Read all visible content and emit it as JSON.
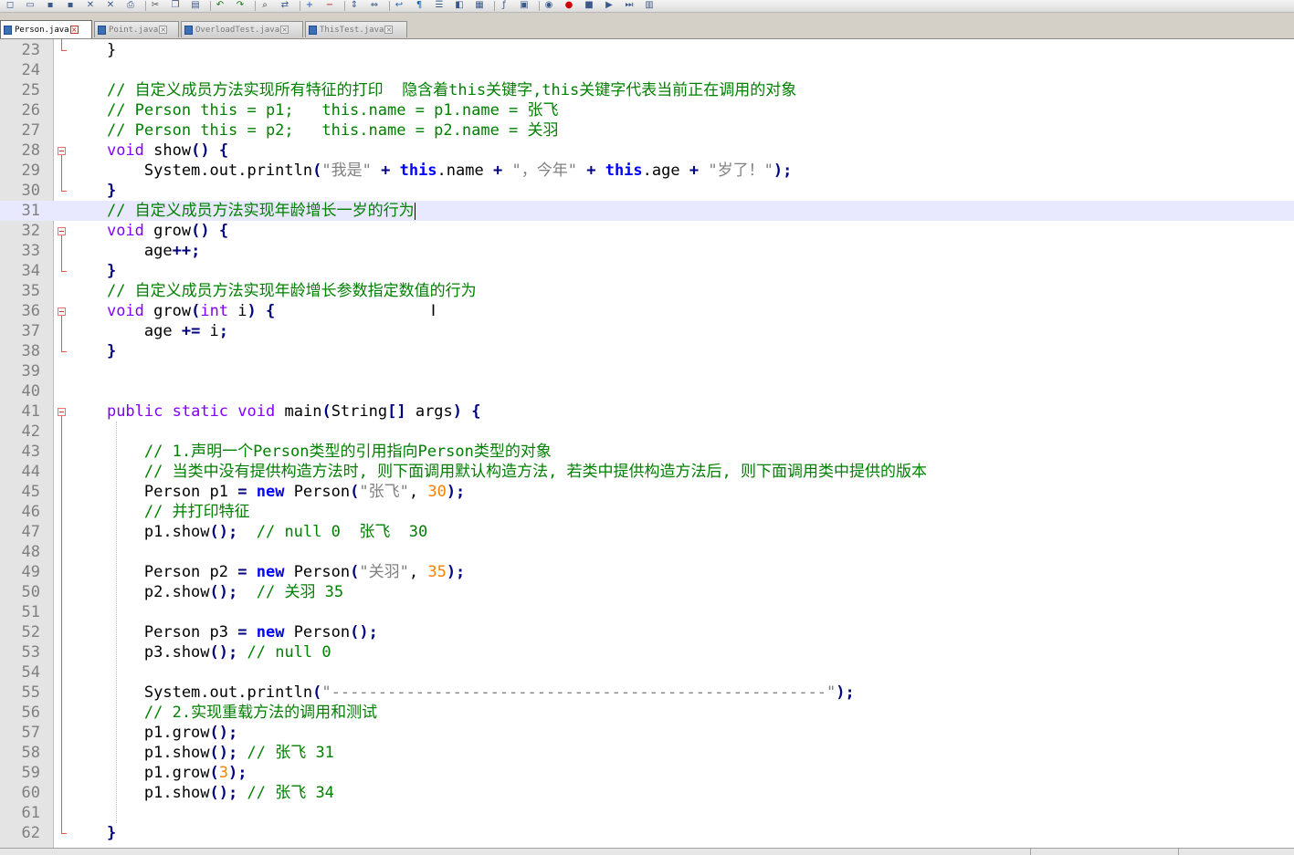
{
  "toolbar": {
    "buttons": [
      "new-file-icon",
      "open-folder-icon",
      "save-icon",
      "save-all-icon",
      "close-icon",
      "close-all-icon",
      "print-icon",
      "cut-icon",
      "copy-icon",
      "paste-icon",
      "undo-icon",
      "redo-icon",
      "find-icon",
      "replace-icon",
      "zoom-in-icon",
      "zoom-out-icon",
      "sync-vertical-icon",
      "sync-horizontal-icon",
      "word-wrap-icon",
      "show-all-chars-icon",
      "indent-guide-icon",
      "user-defined-language-icon",
      "document-map-icon",
      "function-list-icon",
      "folder-as-workspace-icon",
      "monitoring-icon",
      "record-macro-icon",
      "stop-recording-icon",
      "playback-macro-icon",
      "run-macro-multiple-icon",
      "save-macro-icon"
    ]
  },
  "tabs": [
    {
      "label": "Person.java",
      "active": true
    },
    {
      "label": "Point.java",
      "active": false
    },
    {
      "label": "OverloadTest.java",
      "active": false
    },
    {
      "label": "ThisTest.java",
      "active": false
    }
  ],
  "editor": {
    "current_line": 31,
    "lines": [
      {
        "n": "23",
        "t": [
          [
            "    }",
            ""
          ]
        ]
      },
      {
        "n": "24",
        "t": []
      },
      {
        "n": "25",
        "t": [
          [
            "    ",
            ""
          ],
          [
            "// 自定义成员方法实现所有特征的打印  隐含着this关键字,this关键字代表当前正在调用的对象",
            "cm"
          ]
        ]
      },
      {
        "n": "26",
        "t": [
          [
            "    ",
            ""
          ],
          [
            "// Person this = p1;   this.name = p1.name = 张飞",
            "cm"
          ]
        ]
      },
      {
        "n": "27",
        "t": [
          [
            "    ",
            ""
          ],
          [
            "// Person this = p2;   this.name = p2.name = 关羽",
            "cm"
          ]
        ]
      },
      {
        "n": "28",
        "t": [
          [
            "    ",
            ""
          ],
          [
            "void",
            "kw"
          ],
          [
            " show",
            ""
          ],
          [
            "()",
            "op"
          ],
          [
            " ",
            ""
          ],
          [
            "{",
            "op"
          ]
        ]
      },
      {
        "n": "29",
        "t": [
          [
            "        System.out.println",
            ""
          ],
          [
            "(",
            "op"
          ],
          [
            "\"我是\"",
            "str"
          ],
          [
            " ",
            ""
          ],
          [
            "+",
            "op"
          ],
          [
            " ",
            ""
          ],
          [
            "this",
            "kwb"
          ],
          [
            ".name ",
            ""
          ],
          [
            "+",
            "op"
          ],
          [
            " ",
            ""
          ],
          [
            "\"，今年\"",
            "str"
          ],
          [
            " ",
            ""
          ],
          [
            "+",
            "op"
          ],
          [
            " ",
            ""
          ],
          [
            "this",
            "kwb"
          ],
          [
            ".age ",
            ""
          ],
          [
            "+",
            "op"
          ],
          [
            " ",
            ""
          ],
          [
            "\"岁了！\"",
            "str"
          ],
          [
            ");",
            "op"
          ]
        ]
      },
      {
        "n": "30",
        "t": [
          [
            "    ",
            ""
          ],
          [
            "}",
            "op"
          ]
        ]
      },
      {
        "n": "31",
        "t": [
          [
            "    ",
            ""
          ],
          [
            "// 自定义成员方法实现年龄增长一岁的行为",
            "cm"
          ]
        ]
      },
      {
        "n": "32",
        "t": [
          [
            "    ",
            ""
          ],
          [
            "void",
            "kw"
          ],
          [
            " grow",
            ""
          ],
          [
            "()",
            "op"
          ],
          [
            " ",
            ""
          ],
          [
            "{",
            "op"
          ]
        ]
      },
      {
        "n": "33",
        "t": [
          [
            "        age",
            ""
          ],
          [
            "++;",
            "op"
          ]
        ]
      },
      {
        "n": "34",
        "t": [
          [
            "    ",
            ""
          ],
          [
            "}",
            "op"
          ]
        ]
      },
      {
        "n": "35",
        "t": [
          [
            "    ",
            ""
          ],
          [
            "// 自定义成员方法实现年龄增长参数指定数值的行为",
            "cm"
          ]
        ]
      },
      {
        "n": "36",
        "t": [
          [
            "    ",
            ""
          ],
          [
            "void",
            "kw"
          ],
          [
            " grow",
            ""
          ],
          [
            "(",
            "op"
          ],
          [
            "int",
            "kw"
          ],
          [
            " i",
            ""
          ],
          [
            ")",
            "op"
          ],
          [
            " ",
            ""
          ],
          [
            "{",
            "op"
          ]
        ]
      },
      {
        "n": "37",
        "t": [
          [
            "        age ",
            ""
          ],
          [
            "+=",
            "op"
          ],
          [
            " i",
            ""
          ],
          [
            ";",
            "op"
          ]
        ]
      },
      {
        "n": "38",
        "t": [
          [
            "    ",
            ""
          ],
          [
            "}",
            "op"
          ]
        ]
      },
      {
        "n": "39",
        "t": []
      },
      {
        "n": "40",
        "t": []
      },
      {
        "n": "41",
        "t": [
          [
            "    ",
            ""
          ],
          [
            "public",
            "kw"
          ],
          [
            " ",
            ""
          ],
          [
            "static",
            "kw"
          ],
          [
            " ",
            ""
          ],
          [
            "void",
            "kw"
          ],
          [
            " main",
            ""
          ],
          [
            "(",
            "op"
          ],
          [
            "String",
            ""
          ],
          [
            "[]",
            "op"
          ],
          [
            " args",
            ""
          ],
          [
            ")",
            "op"
          ],
          [
            " ",
            ""
          ],
          [
            "{",
            "op"
          ]
        ]
      },
      {
        "n": "42",
        "t": []
      },
      {
        "n": "43",
        "t": [
          [
            "        ",
            ""
          ],
          [
            "// 1.声明一个Person类型的引用指向Person类型的对象",
            "cm"
          ]
        ]
      },
      {
        "n": "44",
        "t": [
          [
            "        ",
            ""
          ],
          [
            "// 当类中没有提供构造方法时, 则下面调用默认构造方法, 若类中提供构造方法后, 则下面调用类中提供的版本",
            "cm"
          ]
        ]
      },
      {
        "n": "45",
        "t": [
          [
            "        Person p1 ",
            ""
          ],
          [
            "=",
            "op"
          ],
          [
            " ",
            ""
          ],
          [
            "new",
            "kwb"
          ],
          [
            " Person",
            ""
          ],
          [
            "(",
            "op"
          ],
          [
            "\"张飞\"",
            "str"
          ],
          [
            ", ",
            ""
          ],
          [
            "30",
            "num"
          ],
          [
            ");",
            "op"
          ]
        ]
      },
      {
        "n": "46",
        "t": [
          [
            "        ",
            ""
          ],
          [
            "// 并打印特征",
            "cm"
          ]
        ]
      },
      {
        "n": "47",
        "t": [
          [
            "        p1.show",
            ""
          ],
          [
            "();",
            "op"
          ],
          [
            "  ",
            ""
          ],
          [
            "// null 0  张飞  30",
            "cm"
          ]
        ]
      },
      {
        "n": "48",
        "t": []
      },
      {
        "n": "49",
        "t": [
          [
            "        Person p2 ",
            ""
          ],
          [
            "=",
            "op"
          ],
          [
            " ",
            ""
          ],
          [
            "new",
            "kwb"
          ],
          [
            " Person",
            ""
          ],
          [
            "(",
            "op"
          ],
          [
            "\"关羽\"",
            "str"
          ],
          [
            ", ",
            ""
          ],
          [
            "35",
            "num"
          ],
          [
            ");",
            "op"
          ]
        ]
      },
      {
        "n": "50",
        "t": [
          [
            "        p2.show",
            ""
          ],
          [
            "();",
            "op"
          ],
          [
            "  ",
            ""
          ],
          [
            "// 关羽 35",
            "cm"
          ]
        ]
      },
      {
        "n": "51",
        "t": []
      },
      {
        "n": "52",
        "t": [
          [
            "        Person p3 ",
            ""
          ],
          [
            "=",
            "op"
          ],
          [
            " ",
            ""
          ],
          [
            "new",
            "kwb"
          ],
          [
            " Person",
            ""
          ],
          [
            "();",
            "op"
          ]
        ]
      },
      {
        "n": "53",
        "t": [
          [
            "        p3.show",
            ""
          ],
          [
            "();",
            "op"
          ],
          [
            " ",
            ""
          ],
          [
            "// null 0",
            "cm"
          ]
        ]
      },
      {
        "n": "54",
        "t": []
      },
      {
        "n": "55",
        "t": [
          [
            "        System.out.println",
            ""
          ],
          [
            "(",
            "op"
          ],
          [
            "\"-----------------------------------------------------\"",
            "str"
          ],
          [
            ");",
            "op"
          ]
        ]
      },
      {
        "n": "56",
        "t": [
          [
            "        ",
            ""
          ],
          [
            "// 2.实现重载方法的调用和测试",
            "cm"
          ]
        ]
      },
      {
        "n": "57",
        "t": [
          [
            "        p1.grow",
            ""
          ],
          [
            "();",
            "op"
          ]
        ]
      },
      {
        "n": "58",
        "t": [
          [
            "        p1.show",
            ""
          ],
          [
            "();",
            "op"
          ],
          [
            " ",
            ""
          ],
          [
            "// 张飞 31",
            "cm"
          ]
        ]
      },
      {
        "n": "59",
        "t": [
          [
            "        p1.grow",
            ""
          ],
          [
            "(",
            "op"
          ],
          [
            "3",
            "num"
          ],
          [
            ");",
            "op"
          ]
        ]
      },
      {
        "n": "60",
        "t": [
          [
            "        p1.show",
            ""
          ],
          [
            "();",
            "op"
          ],
          [
            " ",
            ""
          ],
          [
            "// 张飞 34",
            "cm"
          ]
        ]
      },
      {
        "n": "61",
        "t": []
      },
      {
        "n": "62",
        "t": [
          [
            "    ",
            ""
          ],
          [
            "}",
            "op"
          ]
        ]
      }
    ]
  }
}
